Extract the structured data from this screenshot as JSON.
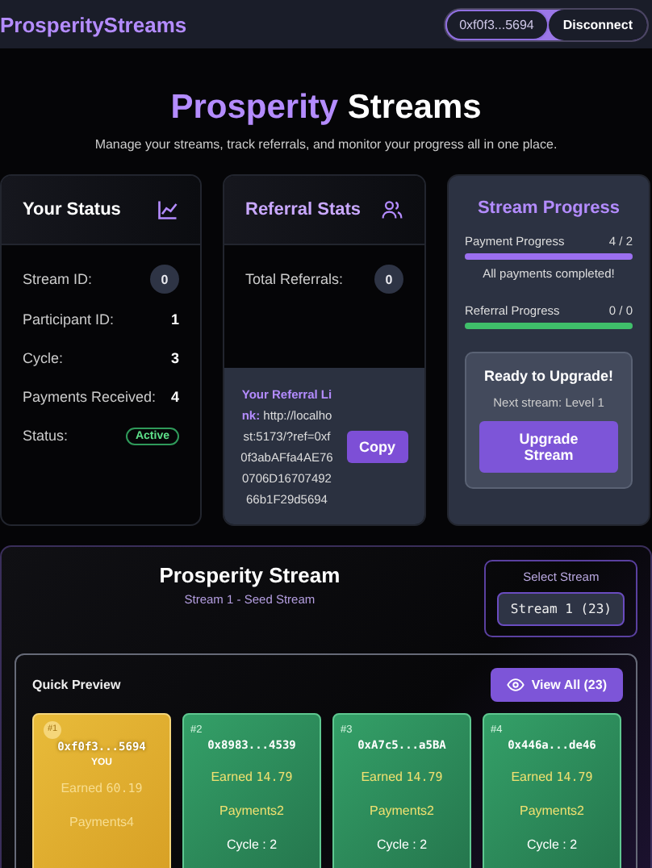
{
  "header": {
    "logo": "ProsperityStreams",
    "wallet": "0xf0f3...5694",
    "disconnect": "Disconnect"
  },
  "hero": {
    "title_accent": "Prosperity",
    "title_rest": "Streams",
    "subtitle": "Manage your streams, track referrals, and monitor your progress all in one place."
  },
  "status_card": {
    "title": "Your Status",
    "rows": [
      {
        "label": "Stream ID:",
        "value": "0",
        "kind": "badge"
      },
      {
        "label": "Participant ID:",
        "value": "1",
        "kind": "plain"
      },
      {
        "label": "Cycle:",
        "value": "3",
        "kind": "plain"
      },
      {
        "label": "Payments Received:",
        "value": "4",
        "kind": "plain"
      },
      {
        "label": "Status:",
        "value": "Active",
        "kind": "status"
      }
    ]
  },
  "referral_card": {
    "title": "Referral Stats",
    "total_label": "Total Referrals:",
    "total": "0",
    "link_text": "**Your Referral Link:** http://localhost:5173/?ref=0xf0f3abAFfa4AE760706D1670749266b1F29d5694",
    "copy": "Copy"
  },
  "progress_card": {
    "title": "Stream Progress",
    "bars": [
      {
        "label": "Payment Progress",
        "reading": "4 / 2",
        "level": 1,
        "color": "#9b6ff0",
        "note": "All payments completed!"
      },
      {
        "label": "Referral Progress",
        "reading": "0 / 0",
        "level": 1,
        "color": "#3fbf6a"
      }
    ],
    "upgrade": {
      "title": "Ready to Upgrade!",
      "next": "Next stream: Level 1",
      "button": "Upgrade Stream"
    }
  },
  "stream": {
    "title": "Prosperity Stream",
    "subtitle": "Stream 1 - Seed Stream",
    "select_label": "Select Stream",
    "select_value": "Stream 1 (23)",
    "preview_title": "Quick Preview",
    "view_all": "View All (23)",
    "members": [
      {
        "rank": "#1",
        "address": "0xf0f3...5694",
        "you": true,
        "you_label": "YOU",
        "earned_label": "Earned",
        "earned": "60.19",
        "payments_label": "Payments",
        "payments": "4"
      },
      {
        "rank": "#2",
        "address": "0x8983...4539",
        "you": false,
        "earned_label": "Earned",
        "earned": "14.79",
        "payments_label": "Payments",
        "payments": "2",
        "cycle": "Cycle : 2"
      },
      {
        "rank": "#3",
        "address": "0xA7c5...a5BA",
        "you": false,
        "earned_label": "Earned",
        "earned": "14.79",
        "payments_label": "Payments",
        "payments": "2",
        "cycle": "Cycle : 2"
      },
      {
        "rank": "#4",
        "address": "0x446a...de46",
        "you": false,
        "earned_label": "Earned",
        "earned": "14.79",
        "payments_label": "Payments",
        "payments": "2",
        "cycle": "Cycle : 2"
      }
    ]
  }
}
